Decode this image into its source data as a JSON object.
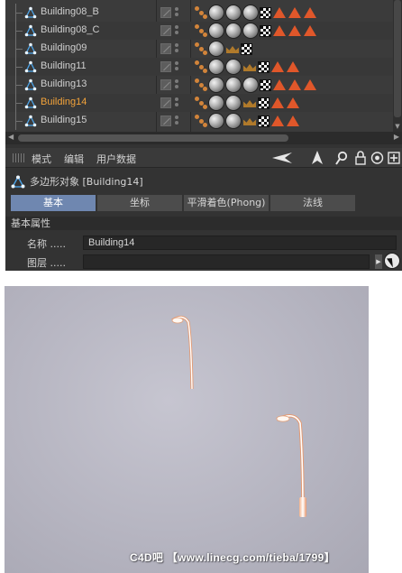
{
  "object_manager": {
    "rows": [
      {
        "name": "Building08_B",
        "tags": [
          "phong",
          "mat",
          "mat",
          "mat",
          "check",
          "tri",
          "tri",
          "tri"
        ],
        "selected": false
      },
      {
        "name": "Building08_C",
        "tags": [
          "phong",
          "mat",
          "mat",
          "mat",
          "check",
          "tri",
          "tri",
          "tri"
        ],
        "selected": false
      },
      {
        "name": "Building09",
        "tags": [
          "phong",
          "mat",
          "crown",
          "check"
        ],
        "selected": false
      },
      {
        "name": "Building11",
        "tags": [
          "phong",
          "mat",
          "mat",
          "crown",
          "check",
          "tri",
          "tri"
        ],
        "selected": false
      },
      {
        "name": "Building13",
        "tags": [
          "phong",
          "mat",
          "mat",
          "mat",
          "check",
          "tri",
          "tri",
          "tri"
        ],
        "selected": false
      },
      {
        "name": "Building14",
        "tags": [
          "phong",
          "mat",
          "mat",
          "crown",
          "check",
          "tri",
          "tri"
        ],
        "selected": true
      },
      {
        "name": "Building15",
        "tags": [
          "phong",
          "mat",
          "mat",
          "crown",
          "check",
          "tri",
          "tri"
        ],
        "selected": false
      }
    ]
  },
  "attribute_manager": {
    "menu": [
      "模式",
      "编辑",
      "用户数据"
    ],
    "toolbar_icons": [
      "back-arrow-icon",
      "cursor-up-icon",
      "search-icon",
      "lock-icon",
      "target-icon",
      "new-panel-icon"
    ],
    "object_title": "多边形对象 [Building14]",
    "tabs": [
      {
        "label": "基本",
        "active": true
      },
      {
        "label": "坐标",
        "active": false
      },
      {
        "label": "平滑着色(Phong)",
        "active": false
      },
      {
        "label": "法线",
        "active": false
      }
    ],
    "section_title": "基本属性",
    "fields": {
      "name_label": "名称 .....",
      "name_value": "Building14",
      "layer_label": "图层 .....",
      "layer_value": ""
    }
  },
  "watermark": "C4D吧 【www.linecg.com/tieba/1799】",
  "colors": {
    "panel_bg": "#333333",
    "selected_text": "#f3a33a",
    "active_tab": "#6f87b0",
    "poly_icon": "#4aa3e8",
    "render_bg": "#b6b5c1"
  }
}
